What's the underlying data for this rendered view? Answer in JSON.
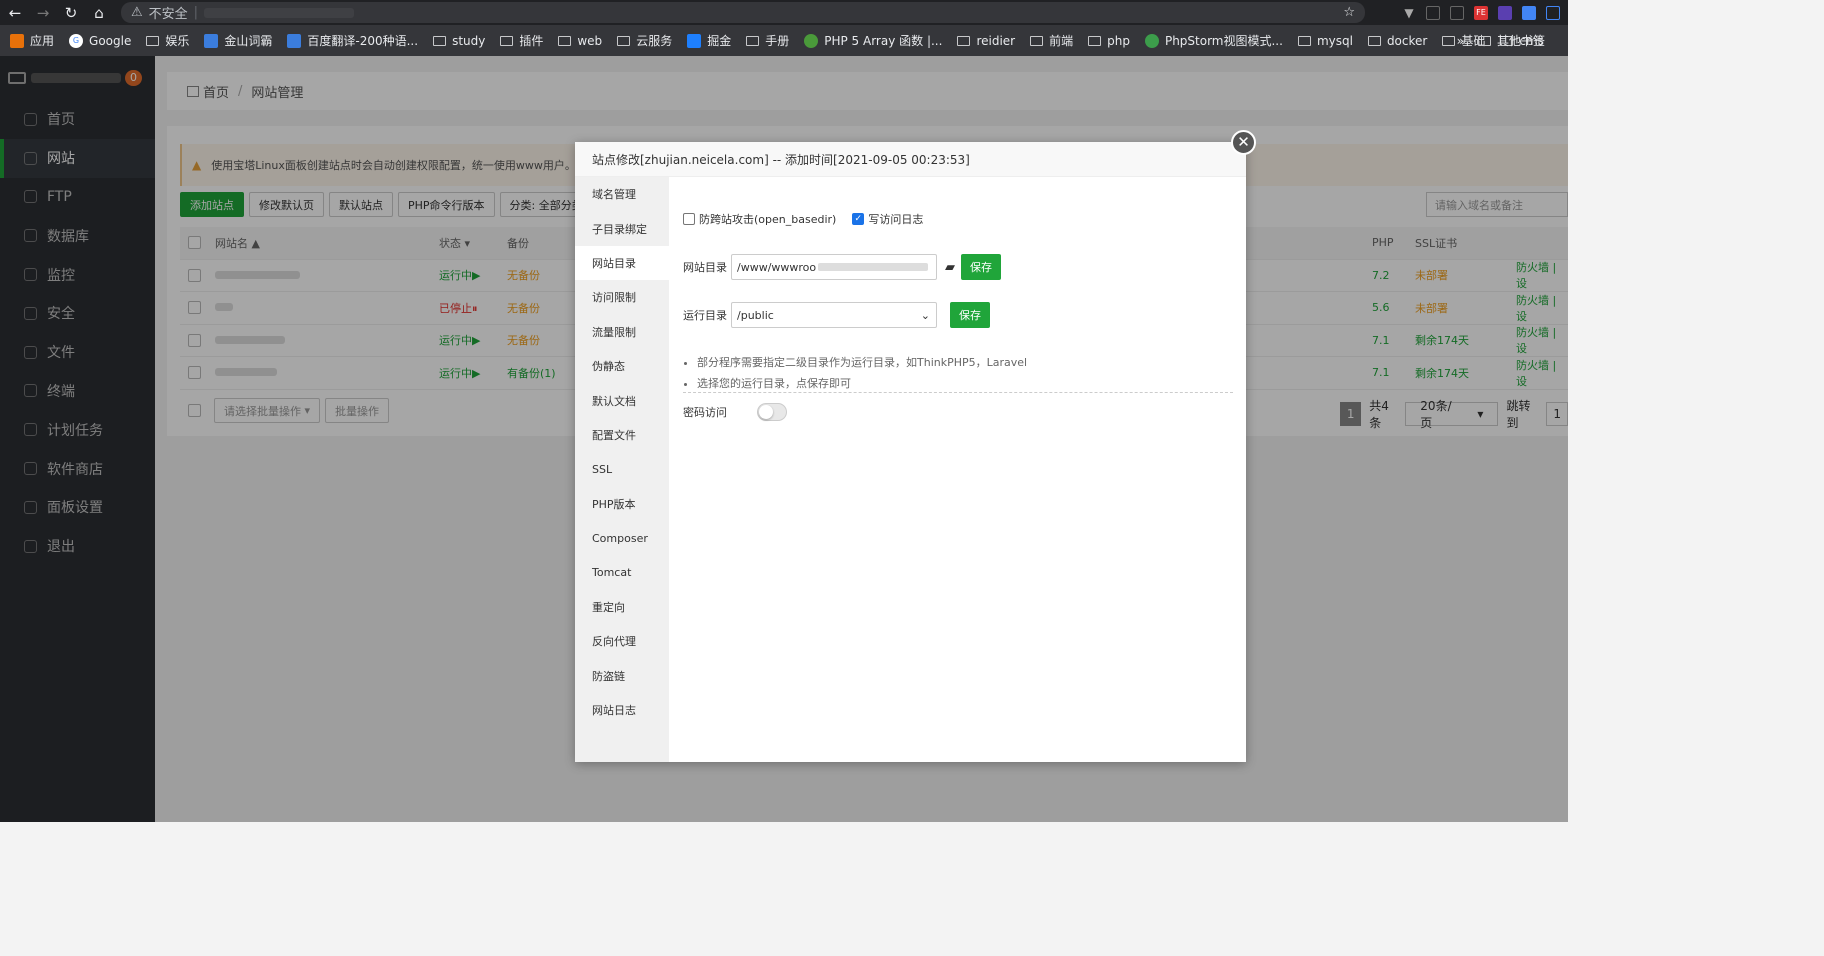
{
  "browser": {
    "security_label": "不安全",
    "bookmarks": [
      "应用",
      "Google",
      "娱乐",
      "金山词霸",
      "百度翻译-200种语...",
      "study",
      "插件",
      "web",
      "云服务",
      "掘金",
      "手册",
      "PHP 5 Array 函数 |...",
      "reidier",
      "前端",
      "php",
      "PhpStorm视图模式...",
      "mysql",
      "docker",
      "基础",
      "cms"
    ],
    "more": "»",
    "other_bookmarks": "其他书签"
  },
  "sidebar": {
    "badge": "0",
    "items": [
      {
        "label": "首页",
        "icon": "home-icon"
      },
      {
        "label": "网站",
        "icon": "globe-icon"
      },
      {
        "label": "FTP",
        "icon": "ftp-icon"
      },
      {
        "label": "数据库",
        "icon": "database-icon"
      },
      {
        "label": "监控",
        "icon": "monitor-icon"
      },
      {
        "label": "安全",
        "icon": "shield-icon"
      },
      {
        "label": "文件",
        "icon": "folder-icon"
      },
      {
        "label": "终端",
        "icon": "terminal-icon"
      },
      {
        "label": "计划任务",
        "icon": "calendar-icon"
      },
      {
        "label": "软件商店",
        "icon": "apps-icon"
      },
      {
        "label": "面板设置",
        "icon": "gear-icon"
      },
      {
        "label": "退出",
        "icon": "logout-icon"
      }
    ]
  },
  "breadcrumb": {
    "home": "首页",
    "current": "网站管理"
  },
  "notice": "使用宝塔Linux面板创建站点时会自动创建权限配置，统一使用www用户。建站后",
  "toolbar": {
    "add_site": "添加站点",
    "edit_default": "修改默认页",
    "default_site": "默认站点",
    "php_cli": "PHP命令行版本",
    "category": "分类: 全部分类",
    "search_placeholder": "请输入域名或备注"
  },
  "table": {
    "headers": {
      "name": "网站名",
      "state": "状态",
      "backup": "备份",
      "php": "PHP",
      "ssl": "SSL证书"
    },
    "rows": [
      {
        "state": "运行中▶",
        "backup": "无备份",
        "php": "7.2",
        "ssl": "未部署",
        "op": "防火墙  |  设"
      },
      {
        "state": "已停止⏸",
        "backup": "无备份",
        "php": "5.6",
        "ssl": "未部署",
        "op": "防火墙  |  设"
      },
      {
        "state": "运行中▶",
        "backup": "无备份",
        "php": "7.1",
        "ssl": "剩余174天",
        "op": "防火墙  |  设"
      },
      {
        "state": "运行中▶",
        "backup": "有备份(1)",
        "php": "7.1",
        "ssl": "剩余174天",
        "op": "防火墙  |  设"
      }
    ],
    "batch_placeholder": "请选择批量操作",
    "batch_button": "批量操作",
    "pager": {
      "current": "1",
      "total": "共4条",
      "per_page": "20条/页",
      "jump_label": "跳转到",
      "jump_value": "1"
    }
  },
  "modal": {
    "title": "站点修改[zhujian.neicela.com] -- 添加时间[2021-09-05 00:23:53]",
    "nav": [
      "域名管理",
      "子目录绑定",
      "网站目录",
      "访问限制",
      "流量限制",
      "伪静态",
      "默认文档",
      "配置文件",
      "SSL",
      "PHP版本",
      "Composer",
      "Tomcat",
      "重定向",
      "反向代理",
      "防盗链",
      "网站日志"
    ],
    "anti_xss_label": "防跨站攻击(open_basedir)",
    "write_log_label": "写访问日志",
    "site_dir_label": "网站目录",
    "site_dir_value": "/www/wwwroo",
    "save": "保存",
    "run_dir_label": "运行目录",
    "run_dir_value": "/public",
    "tips": [
      "部分程序需要指定二级目录作为运行目录，如ThinkPHP5，Laravel",
      "选择您的运行目录，点保存即可"
    ],
    "password_label": "密码访问"
  }
}
